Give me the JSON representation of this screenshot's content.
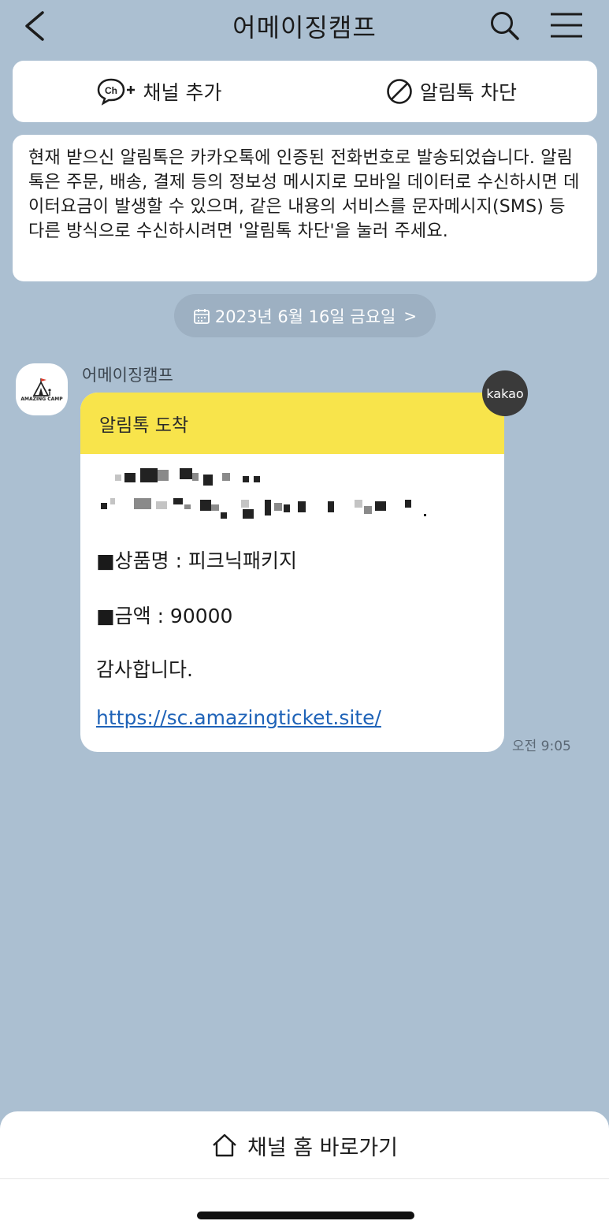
{
  "header": {
    "title": "어메이징캠프"
  },
  "actions": {
    "add_channel": "채널 추가",
    "block": "알림톡 차단"
  },
  "notice": {
    "text": "현재 받으신 알림톡은 카카오톡에 인증된 전화번호로 발송되었습니다. 알림톡은 주문, 배송, 결제 등의 정보성 메시지로 모바일 데이터로 수신하시면 데이터요금이 발생할 수 있으며, 같은 내용의 서비스를 문자메시지(SMS) 등 다른 방식으로 수신하시려면 '알림톡 차단'을 눌러 주세요."
  },
  "date_pill": {
    "label": "2023년 6월 16일 금요일",
    "chevron": ">"
  },
  "message": {
    "avatar_text": "AMAZING CAMP",
    "sender": "어메이징캠프",
    "badge": "kakao",
    "header": "알림톡 도착",
    "product": "■상품명 : 피크닉패키지",
    "amount": "■금액 : 90000",
    "thanks": "감사합니다.",
    "link": "https://sc.amazingticket.site/",
    "time": "오전 9:05"
  },
  "bottom": {
    "home_label": "채널 홈 바로가기"
  }
}
